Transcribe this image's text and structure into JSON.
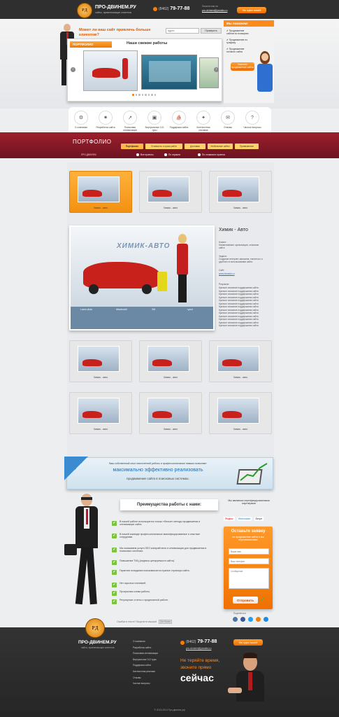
{
  "header": {
    "logo_letters": "PД",
    "brand": "ПРО-ДВИНЕМ.РУ",
    "tagline": "сайты, привлекающие клиентов",
    "phone_code": "(8462)",
    "phone_number": "79-77-88",
    "email_label": "Пишите нам на",
    "email": "pro-dvinem@yandex.ru",
    "callback_button": "Мы ждем вашей"
  },
  "hero": {
    "question": "Может ли ваш сайт привлечь больше клиентов?",
    "search_placeholder": "адрес",
    "check_button": "Проверить",
    "help_title": "Мы поможем!",
    "help_items": [
      "Продвижение сайтов по позициям",
      "Продвижение по трафику",
      "Продвижение готового сайта"
    ],
    "order_button": "Заказать продвижение сайта"
  },
  "slider": {
    "tab": "ПОРТФОЛИО",
    "title": "Наши свежие работы",
    "dots": 8
  },
  "nav": [
    {
      "icon": "settings-icon",
      "label": "О компании"
    },
    {
      "icon": "gear-icon",
      "label": "Разработка сайта"
    },
    {
      "icon": "chart-icon",
      "label": "Поисковая оптимизация"
    },
    {
      "icon": "cube-icon",
      "label": "Виртуальные 3-D туры"
    },
    {
      "icon": "ship-icon",
      "label": "Поддержка сайта"
    },
    {
      "icon": "bulb-icon",
      "label": "Контекстная реклама"
    },
    {
      "icon": "chat-icon",
      "label": "Отзывы"
    },
    {
      "icon": "question-icon",
      "label": "Частые вопросы"
    }
  ],
  "portfolio": {
    "title": "ПОРТФОЛИО",
    "breadcrumb": "ПРО-ДВИНЕМ",
    "tabs": [
      "Портфолио",
      "Стоимость и сроки работ",
      "Доставка",
      "Мобильные сайты",
      "Привязанные"
    ],
    "filters": [
      "Все проекты",
      "По отрасли",
      "По стоимости проекта"
    ],
    "thumb_caption": "Химик - авто",
    "featured": {
      "title": "Химик - Авто",
      "site_overlay": "ХИМИК-АВТО",
      "client_label": "Клиент:",
      "client_text": "Наименование организации, описание сайта",
      "task_label": "Задача:",
      "task_text": "Создание интернет-магазина, понятного и удобного в использовании сайта",
      "site_label": "Сайт:",
      "site_url": "www.himavto.ru",
      "result_label": "Результат:",
      "result_lines": [
        "Краткое описание поддержания сайта",
        "Краткое описание поддержания сайта",
        "Краткое описание поддержания сайта",
        "Краткое описание поддержания сайта",
        "Краткое описание поддержания сайта",
        "Краткое описание поддержания сайта",
        "Краткое описание поддержания сайта",
        "Краткое описание поддержания сайта",
        "Краткое описание поддержания сайта",
        "Краткое описание поддержания сайта",
        "Краткое описание поддержания сайта",
        "Краткое описание поддержания сайта",
        "Краткое описание поддержания сайта"
      ],
      "product_labels": [
        "Lavor-Auto",
        "Maximobil",
        "3M",
        "sys/z"
      ]
    }
  },
  "banner": {
    "line1": "Ваш собственный опыт многолетней работы и профессиональные навыки позволяют",
    "line2": "максимально эффективно реализовать",
    "line3": "продвижение сайта в поисковых системах."
  },
  "advantages": {
    "title": "Преимущества работы с нами:",
    "items": [
      "В нашей работе используются только «белые» методы продвижения и оптимизации сайта.",
      "В нашей команде профессиональные квалифицированные и опытные сотрудники.",
      "Мы оказываем услуги SEO копирайтинга и оптимизации для продвижения в поисковых системах.",
      "Повышение ТИЦ (индекса цитируемости сайта).",
      "Гарантия попадания поисковиков на нужные страницы сайта.",
      "Нет скрытых платежей.",
      "Прозрачная схема работы.",
      "Регулярные отчеты о проделанной работе."
    ]
  },
  "partners": {
    "title": "Мы являемся сертифицированными партнерами",
    "logos": [
      "Яндекс",
      "Webmaster",
      "Бегун"
    ]
  },
  "form": {
    "title": "Оставьте заявку",
    "subtitle": "на продвижение сайта и мы перезвоним вам!",
    "name_placeholder": "Ваше имя",
    "phone_placeholder": "Ваш телефон",
    "message_placeholder": "Сообщение",
    "submit": "Отправить"
  },
  "social": {
    "label": "Поделиться",
    "icons": [
      "vk-icon",
      "facebook-icon",
      "twitter-icon",
      "ok-icon",
      "mail-icon"
    ]
  },
  "footer": {
    "error_notice": "Ошибка в тексте? Выделите мышкой",
    "error_keys": "Ctrl+Enter",
    "links": [
      "О компании",
      "Разработка сайта",
      "Поисковая оптимизация",
      "Виртуальные 3-D туры",
      "Поддержка сайта",
      "Контекстная реклама",
      "Отзывы",
      "Частые вопросы"
    ],
    "slogan_line1": "Не теряйте время,",
    "slogan_line2": "звоните прямо",
    "slogan_now": "сейчас",
    "copyright": "© 2013-2014 Про-двинем.рф"
  },
  "colors": {
    "accent": "#ff7a00",
    "portfolio_red": "#8a1a25",
    "dark": "#2f2f2f",
    "check": "#7cc43d"
  }
}
